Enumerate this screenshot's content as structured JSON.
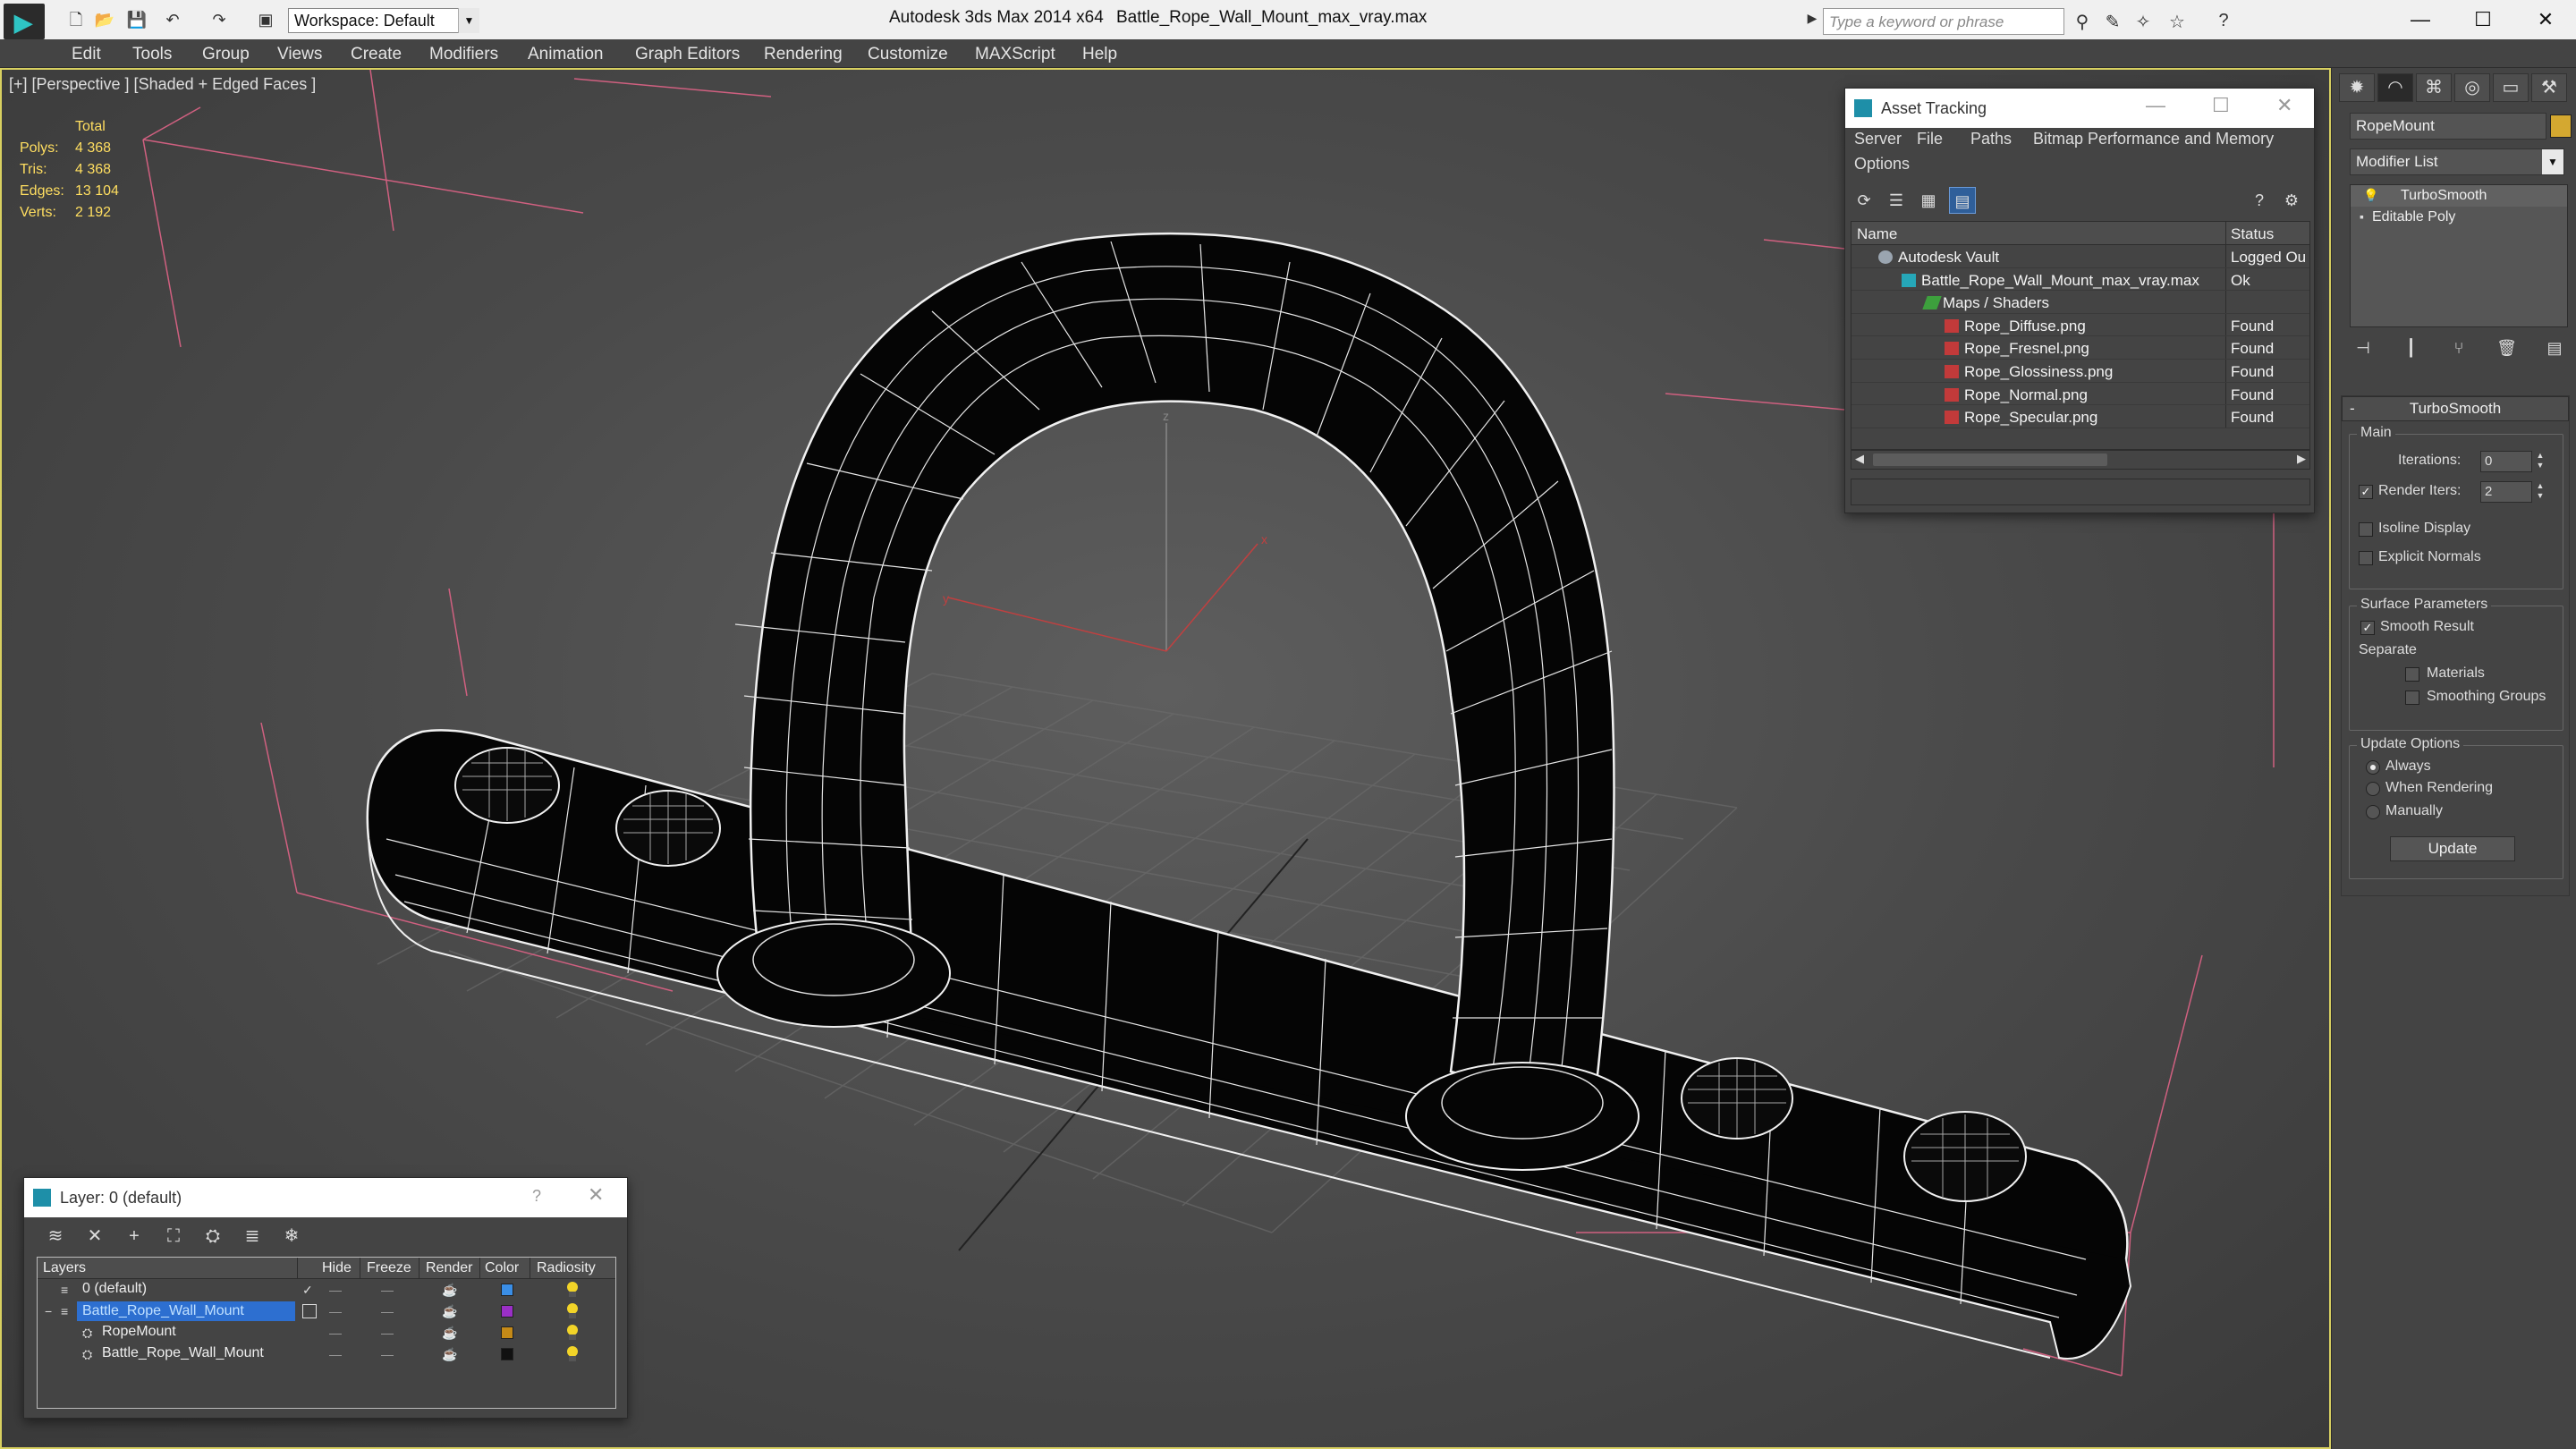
{
  "titlebar": {
    "workspace": "Workspace: Default",
    "app_title": "Autodesk 3ds Max  2014 x64",
    "file_title": "Battle_Rope_Wall_Mount_max_vray.max",
    "search_placeholder": "Type a keyword or phrase",
    "minimize": "—",
    "maximize": "☐",
    "close": "✕"
  },
  "menu": [
    "Edit",
    "Tools",
    "Group",
    "Views",
    "Create",
    "Modifiers",
    "Animation",
    "Graph Editors",
    "Rendering",
    "Customize",
    "MAXScript",
    "Help"
  ],
  "viewport": {
    "label": "[+] [Perspective ] [Shaded + Edged Faces ]",
    "stats": {
      "header": "Total",
      "rows": [
        {
          "k": "Polys:",
          "v": "4 368"
        },
        {
          "k": "Tris:",
          "v": "4 368"
        },
        {
          "k": "Edges:",
          "v": "13 104"
        },
        {
          "k": "Verts:",
          "v": "2 192"
        }
      ]
    },
    "axis": {
      "x": "x",
      "y": "y",
      "z": "z"
    }
  },
  "asset_tracking": {
    "title": "Asset Tracking",
    "menu": [
      "Server",
      "File",
      "Paths",
      "Bitmap Performance and Memory",
      "Options"
    ],
    "columns": {
      "name": "Name",
      "status": "Status"
    },
    "rows": [
      {
        "name": "Autodesk Vault",
        "status": "Logged Ou",
        "icon": "vault-icon"
      },
      {
        "name": "Battle_Rope_Wall_Mount_max_vray.max",
        "status": "Ok",
        "icon": "max-file-icon"
      },
      {
        "name": "Maps / Shaders",
        "status": "",
        "icon": "maps-folder-icon"
      },
      {
        "name": "Rope_Diffuse.png",
        "status": "Found",
        "icon": "png-icon"
      },
      {
        "name": "Rope_Fresnel.png",
        "status": "Found",
        "icon": "png-icon"
      },
      {
        "name": "Rope_Glossiness.png",
        "status": "Found",
        "icon": "png-icon"
      },
      {
        "name": "Rope_Normal.png",
        "status": "Found",
        "icon": "png-icon"
      },
      {
        "name": "Rope_Specular.png",
        "status": "Found",
        "icon": "png-icon"
      }
    ]
  },
  "layer_window": {
    "title": "Layer: 0 (default)",
    "help": "?",
    "columns": {
      "layers": "Layers",
      "hide": "Hide",
      "freeze": "Freeze",
      "render": "Render",
      "color": "Color",
      "radiosity": "Radiosity"
    },
    "rows": [
      {
        "name": "0 (default)",
        "color": "#3a8ee6"
      },
      {
        "name": "Battle_Rope_Wall_Mount",
        "color": "#9a2fc6"
      },
      {
        "name": "RopeMount",
        "color": "#c58a17"
      },
      {
        "name": "Battle_Rope_Wall_Mount",
        "color": "#111111"
      }
    ]
  },
  "command_panel": {
    "object_name": "RopeMount",
    "object_color": "#d4a830",
    "modifier_list": "Modifier List",
    "stack": [
      "TurboSmooth",
      "Editable Poly"
    ],
    "rollout": {
      "title": "TurboSmooth",
      "main": "Main",
      "iterations_label": "Iterations:",
      "iterations": "0",
      "render_iters_label": "Render Iters:",
      "render_iters": "2",
      "render_iters_checked": true,
      "isoline": "Isoline Display",
      "explicit_normals": "Explicit Normals",
      "surface_params": "Surface Parameters",
      "smooth_result": "Smooth Result",
      "separate": "Separate",
      "materials": "Materials",
      "smoothing_groups": "Smoothing Groups",
      "update_options": "Update Options",
      "always": "Always",
      "when_rendering": "When Rendering",
      "manually": "Manually",
      "update": "Update"
    }
  }
}
